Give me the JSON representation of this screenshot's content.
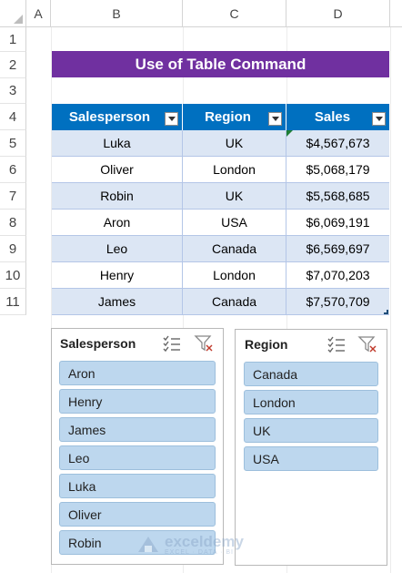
{
  "columns": [
    "A",
    "B",
    "C",
    "D"
  ],
  "rows": [
    "1",
    "2",
    "3",
    "4",
    "5",
    "6",
    "7",
    "8",
    "9",
    "10",
    "11"
  ],
  "title": "Use of Table Command",
  "table": {
    "headers": [
      "Salesperson",
      "Region",
      "Sales"
    ],
    "rows": [
      [
        "Luka",
        "UK",
        "$4,567,673"
      ],
      [
        "Oliver",
        "London",
        "$5,068,179"
      ],
      [
        "Robin",
        "UK",
        "$5,568,685"
      ],
      [
        "Aron",
        "USA",
        "$6,069,191"
      ],
      [
        "Leo",
        "Canada",
        "$6,569,697"
      ],
      [
        "Henry",
        "London",
        "$7,070,203"
      ],
      [
        "James",
        "Canada",
        "$7,570,709"
      ]
    ]
  },
  "slicers": [
    {
      "title": "Salesperson",
      "items": [
        "Aron",
        "Henry",
        "James",
        "Leo",
        "Luka",
        "Oliver",
        "Robin"
      ]
    },
    {
      "title": "Region",
      "items": [
        "Canada",
        "London",
        "UK",
        "USA"
      ]
    }
  ],
  "watermark": {
    "brand": "exceldemy",
    "tagline": "EXCEL · DATA · BI"
  },
  "colors": {
    "title_bg": "#7030a0",
    "header_bg": "#0070c0",
    "band": "#dce6f4",
    "slicer_item": "#bdd7ee"
  }
}
